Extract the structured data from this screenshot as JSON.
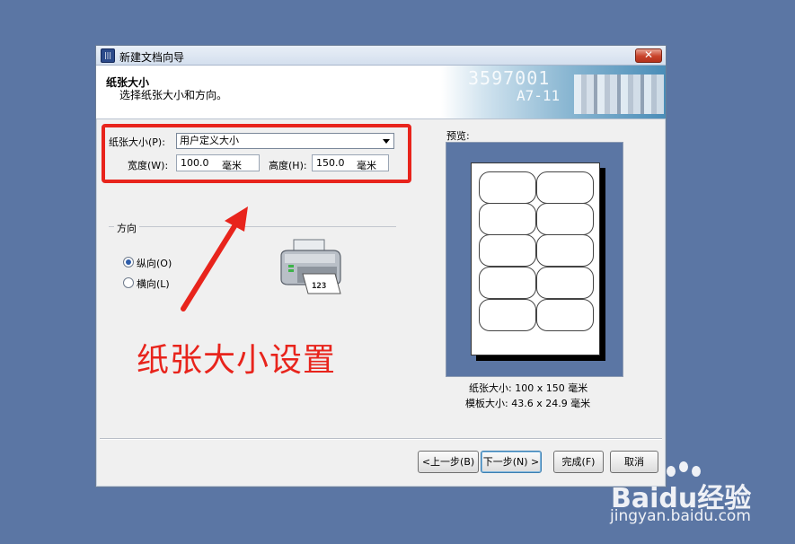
{
  "window": {
    "title": "新建文档向导",
    "app_icon_text": "|||",
    "close_label": "✕"
  },
  "header": {
    "title": "纸张大小",
    "subtitle": "选择纸张大小和方向。",
    "banner_text1": "3597001",
    "banner_text2": "A7-11"
  },
  "paper": {
    "size_label": "纸张大小(P):",
    "size_value": "用户定义大小",
    "width_label": "宽度(W):",
    "width_value": "100.0",
    "width_unit": "毫米",
    "height_label": "高度(H):",
    "height_value": "150.0",
    "height_unit": "毫米"
  },
  "orientation": {
    "group_title": "方向",
    "portrait_label": "纵向(O)",
    "landscape_label": "横向(L)",
    "selected": "portrait"
  },
  "printer_icon_text": "123",
  "preview": {
    "label": "预览:",
    "paper_size_text": "纸张大小: 100 x 150 毫米",
    "template_size_text": "模板大小: 43.6 x 24.9 毫米"
  },
  "buttons": {
    "back": "<上一步(B)",
    "next": "下一步(N) >",
    "finish": "完成(F)",
    "cancel": "取消"
  },
  "annotation": {
    "text": "纸张大小设置",
    "color": "#e8241c"
  },
  "watermark": {
    "brand": "Bai",
    "brand2": "du",
    "brand3": "经验",
    "url": "jingyan.baidu.com"
  },
  "colors": {
    "desktop": "#5b76a4",
    "accent_red": "#e8241c"
  }
}
